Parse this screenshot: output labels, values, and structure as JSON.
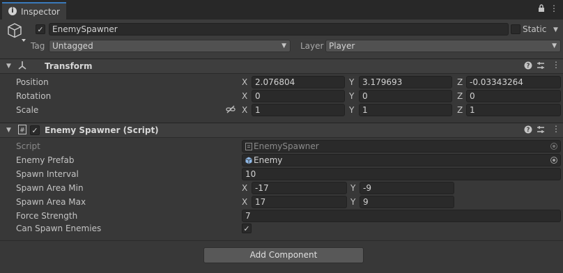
{
  "tab": {
    "title": "Inspector"
  },
  "gameobject": {
    "name": "EnemySpawner",
    "static_label": "Static",
    "tag_label": "Tag",
    "tag_value": "Untagged",
    "layer_label": "Layer",
    "layer_value": "Player"
  },
  "transform": {
    "title": "Transform",
    "rows": [
      {
        "label": "Position",
        "x": "2.076804",
        "y": "3.179693",
        "z": "-0.03343264"
      },
      {
        "label": "Rotation",
        "x": "0",
        "y": "0",
        "z": "0"
      },
      {
        "label": "Scale",
        "x": "1",
        "y": "1",
        "z": "1"
      }
    ],
    "axes": [
      "X",
      "Y",
      "Z"
    ]
  },
  "script_component": {
    "title": "Enemy Spawner (Script)",
    "script_label": "Script",
    "script_value": "EnemySpawner",
    "prefab_label": "Enemy Prefab",
    "prefab_value": "Enemy",
    "interval_label": "Spawn Interval",
    "interval_value": "10",
    "area_min_label": "Spawn Area Min",
    "area_min_x": "-17",
    "area_min_y": "-9",
    "area_max_label": "Spawn Area Max",
    "area_max_x": "17",
    "area_max_y": "9",
    "force_label": "Force Strength",
    "force_value": "7",
    "can_spawn_label": "Can Spawn Enemies",
    "can_spawn_checked": true
  },
  "add_component_label": "Add Component",
  "icons": [
    "info-icon",
    "lock-icon",
    "menu-icon",
    "cube-icon",
    "transform-icon",
    "script-icon",
    "help-icon",
    "preset-icon",
    "more-icon",
    "link-icon",
    "object-picker-icon"
  ]
}
